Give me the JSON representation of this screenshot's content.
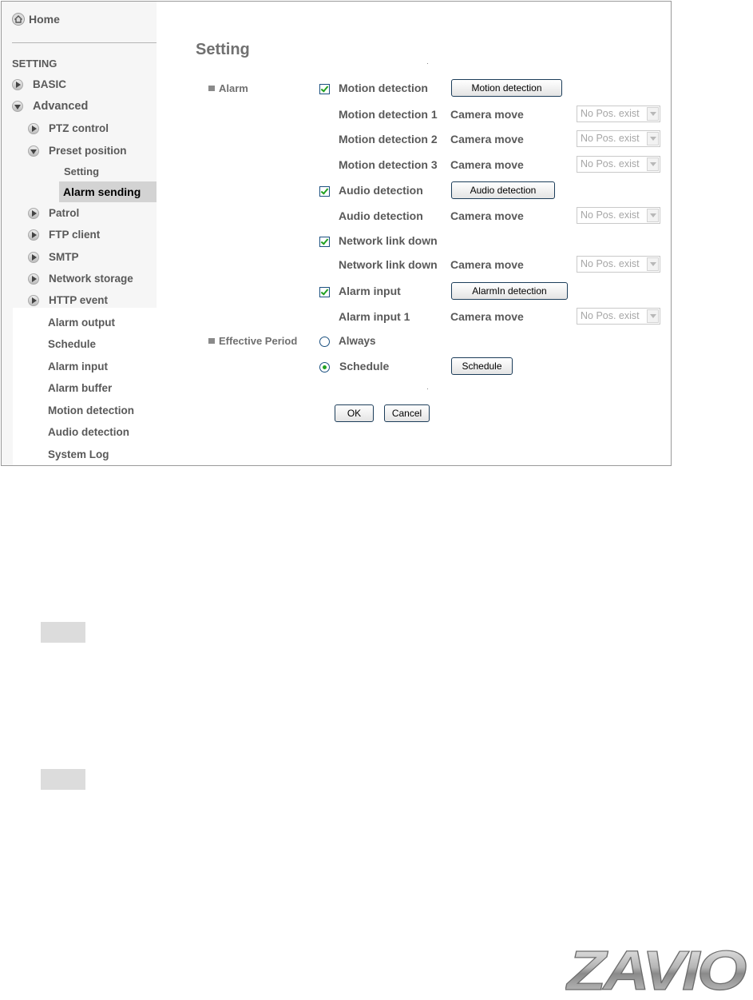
{
  "sidebar": {
    "home_label": "Home",
    "setting_header": "SETTING",
    "items": [
      {
        "label": "BASIC"
      },
      {
        "label": "Advanced"
      },
      {
        "label": "PTZ control"
      },
      {
        "label": "Preset position"
      },
      {
        "label": "Setting"
      },
      {
        "label": "Alarm sending"
      },
      {
        "label": "Patrol"
      },
      {
        "label": "FTP client"
      },
      {
        "label": "SMTP"
      },
      {
        "label": "Network storage"
      },
      {
        "label": "HTTP event"
      },
      {
        "label": "Alarm output"
      },
      {
        "label": "Schedule"
      },
      {
        "label": "Alarm input"
      },
      {
        "label": "Alarm buffer"
      },
      {
        "label": "Motion detection"
      },
      {
        "label": "Audio detection"
      },
      {
        "label": "System Log"
      }
    ]
  },
  "main": {
    "title": "Setting",
    "alarm_section": "Alarm",
    "period_section": "Effective Period",
    "camera_move_label": "Camera move",
    "select_value": "No Pos. exist",
    "motion": {
      "check_label": "Motion detection",
      "button": "Motion detection",
      "rows": [
        "Motion detection 1",
        "Motion detection 2",
        "Motion detection 3"
      ]
    },
    "audio": {
      "check_label": "Audio detection",
      "button": "Audio detection",
      "row": "Audio detection"
    },
    "network": {
      "check_label": "Network link down",
      "row": "Network link down"
    },
    "alarm_input": {
      "check_label": "Alarm input",
      "button": "AlarmIn detection",
      "row": "Alarm input 1"
    },
    "period": {
      "always": "Always",
      "schedule": "Schedule",
      "schedule_button": "Schedule",
      "selected": "Schedule"
    },
    "ok_button": "OK",
    "cancel_button": "Cancel"
  },
  "logo": {
    "text": "ZAVIO"
  }
}
